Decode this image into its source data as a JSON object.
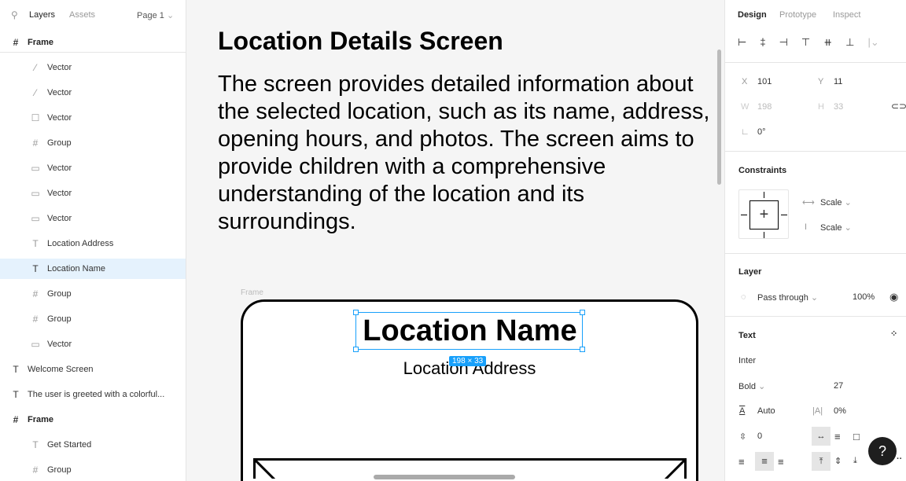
{
  "left": {
    "tabs": [
      "Layers",
      "Assets"
    ],
    "page": "Page 1",
    "layers": [
      {
        "label": "Frame",
        "icon": "frame-icon",
        "level": 0,
        "bold": true
      },
      {
        "label": "Vector",
        "icon": "line-icon",
        "level": 1
      },
      {
        "label": "Vector",
        "icon": "line-icon",
        "level": 1
      },
      {
        "label": "Vector",
        "icon": "square-icon",
        "level": 1
      },
      {
        "label": "Group",
        "icon": "frame-icon",
        "level": 1
      },
      {
        "label": "Vector",
        "icon": "rect-icon",
        "level": 1
      },
      {
        "label": "Vector",
        "icon": "rect-icon",
        "level": 1
      },
      {
        "label": "Vector",
        "icon": "rect-icon",
        "level": 1
      },
      {
        "label": "Location Address",
        "icon": "text-icon",
        "level": 1
      },
      {
        "label": "Location Name",
        "icon": "text-icon",
        "level": 1,
        "selected": true
      },
      {
        "label": "Group",
        "icon": "frame-icon",
        "level": 1
      },
      {
        "label": "Group",
        "icon": "frame-icon",
        "level": 1
      },
      {
        "label": "Vector",
        "icon": "rect-icon",
        "level": 1
      },
      {
        "label": "Welcome Screen",
        "icon": "text-icon",
        "level": 0
      },
      {
        "label": "The user is greeted with a colorful...",
        "icon": "text-icon",
        "level": 0
      },
      {
        "label": "Frame",
        "icon": "frame-icon",
        "level": 0,
        "bold": true
      },
      {
        "label": "Get Started",
        "icon": "text-icon",
        "level": 1
      },
      {
        "label": "Group",
        "icon": "frame-icon",
        "level": 1
      }
    ]
  },
  "canvas": {
    "title": "Location Details Screen",
    "lines": [
      "The screen provides detailed information about",
      "the selected location, such as its name, address,",
      "opening hours, and photos. The screen aims to",
      "provide children with a comprehensive",
      "understanding of the location and its",
      "surroundings."
    ],
    "frame_label": "Frame",
    "name": "Location Name",
    "address": "Location Address",
    "size_badge": "198 × 33",
    "accent": "#18a0fb"
  },
  "right": {
    "tabs": [
      "Design",
      "Prototype",
      "Inspect"
    ],
    "x_label": "X",
    "x": "101",
    "y_label": "Y",
    "y": "11",
    "w_label": "W",
    "w": "198",
    "h_label": "H",
    "h": "33",
    "rotation": "0°",
    "constraints": {
      "title": "Constraints",
      "h": "Scale",
      "v": "Scale"
    },
    "layer": {
      "title": "Layer",
      "blend": "Pass through",
      "opacity": "100%"
    },
    "text": {
      "title": "Text",
      "font": "Inter",
      "weight": "Bold",
      "size": "27",
      "line_height": "Auto",
      "letter_spacing": "0%",
      "paragraph": "0"
    },
    "help": "?"
  }
}
